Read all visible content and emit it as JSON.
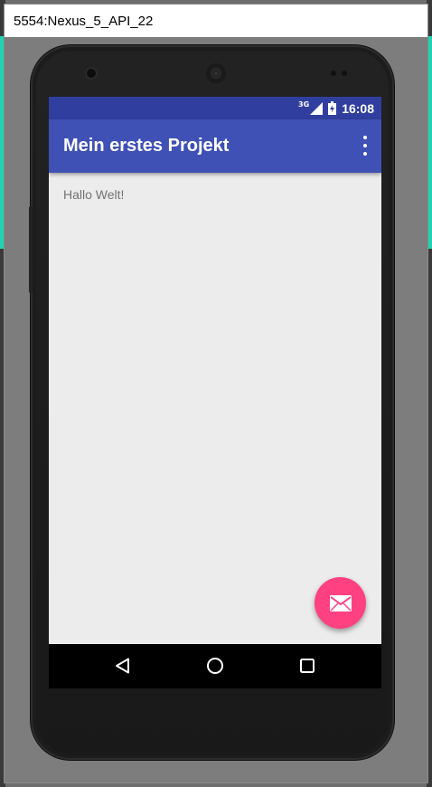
{
  "window": {
    "title": "5554:Nexus_5_API_22"
  },
  "status_bar": {
    "network": "3G",
    "time": "16:08",
    "icons": [
      "signal-icon",
      "battery-icon"
    ]
  },
  "app_bar": {
    "title": "Mein erstes Projekt",
    "overflow_icon": "more-vert-icon"
  },
  "content": {
    "text": "Hallo Welt!"
  },
  "fab": {
    "icon": "email-icon"
  },
  "nav_bar": {
    "buttons": [
      "back-icon",
      "home-icon",
      "recents-icon"
    ]
  },
  "colors": {
    "status_bar": "#303f9f",
    "app_bar": "#3f51b5",
    "fab": "#ff4081",
    "screen_bg": "#ececec",
    "nav_bar": "#000000"
  }
}
